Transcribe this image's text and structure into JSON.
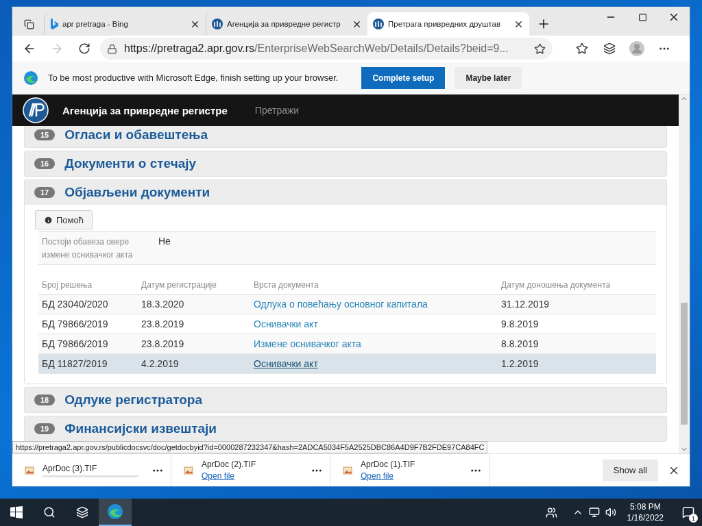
{
  "tabs": [
    {
      "title": "apr pretraga - Bing",
      "kind": "bing",
      "selected": false
    },
    {
      "title": "Агенција за привредне регистр",
      "kind": "apr",
      "selected": false
    },
    {
      "title": "Претрага привредних друштав",
      "kind": "apr",
      "selected": true
    }
  ],
  "address": {
    "host": "https://pretraga2.apr.gov.rs",
    "path": "/EnterpriseWebSearchWeb/Details/Details?beid=9..."
  },
  "infobar": {
    "message": "To be most productive with Microsoft Edge, finish setting up your browser.",
    "primary": "Complete setup",
    "secondary": "Maybe later"
  },
  "site": {
    "title": "Агенција за привредне регистре",
    "nav": [
      "Претражи"
    ]
  },
  "sections": [
    {
      "number": "15",
      "title": "Огласи и обавештења",
      "expanded": false
    },
    {
      "number": "16",
      "title": "Документи о стечају",
      "expanded": false
    },
    {
      "number": "17",
      "title": "Објављени документи",
      "expanded": true
    },
    {
      "number": "18",
      "title": "Одлуке регистратора",
      "expanded": false
    },
    {
      "number": "19",
      "title": "Финансијски извештаји",
      "expanded": false
    }
  ],
  "published": {
    "help": "Помоћ",
    "obligation_label": "Постоји обавеза овере измене оснивачког акта",
    "obligation_value": "Не",
    "columns": [
      "Број решења",
      "Датум регистрације",
      "Врста документа",
      "Датум доношења документа"
    ],
    "rows": [
      {
        "cells": [
          "БД 23040/2020",
          "18.3.2020",
          "Одлука о повећању основног капитала",
          "31.12.2019"
        ],
        "hovered": false
      },
      {
        "cells": [
          "БД 79866/2019",
          "23.8.2019",
          "Оснивачки акт",
          "9.8.2019"
        ],
        "hovered": false
      },
      {
        "cells": [
          "БД 79866/2019",
          "23.8.2019",
          "Измене оснивачког акта",
          "8.8.2019"
        ],
        "hovered": false
      },
      {
        "cells": [
          "БД 11827/2019",
          "4.2.2019",
          "Оснивачки акт",
          "1.2.2019"
        ],
        "hovered": true
      }
    ]
  },
  "status_url": "https://pretraga2.apr.gov.rs/publicdocsvc/doc/getdocbyid?id=0000287232347&hash=2ADCA5034F5A2525DBC86A4D9F7B2FDE97CA84FC",
  "downloads": [
    {
      "name": "AprDoc (3).TIF",
      "kind": "progress"
    },
    {
      "name": "AprDoc (2).TIF",
      "kind": "done",
      "action": "Open file"
    },
    {
      "name": "AprDoc (1).TIF",
      "kind": "done",
      "action": "Open file"
    }
  ],
  "show_all": "Show all",
  "taskbar": {
    "time": "5:08 PM",
    "date": "1/16/2022",
    "notifications": "1"
  }
}
